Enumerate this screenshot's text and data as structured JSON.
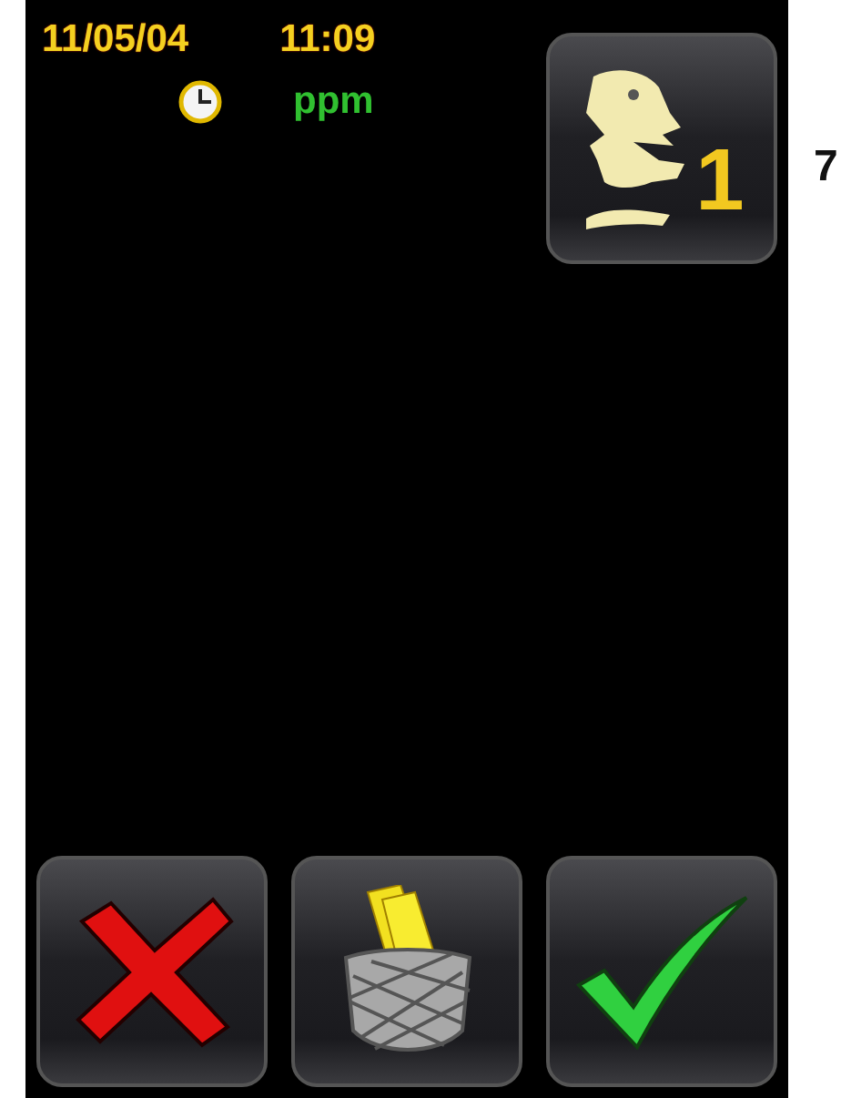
{
  "date": "11/05/04",
  "time": "11:09",
  "unit": "ppm",
  "speaker_button": {
    "label": "1"
  },
  "side_label": "7",
  "buttons": [
    {
      "kind": "cancel"
    },
    {
      "kind": "basket"
    },
    {
      "kind": "confirm"
    }
  ]
}
